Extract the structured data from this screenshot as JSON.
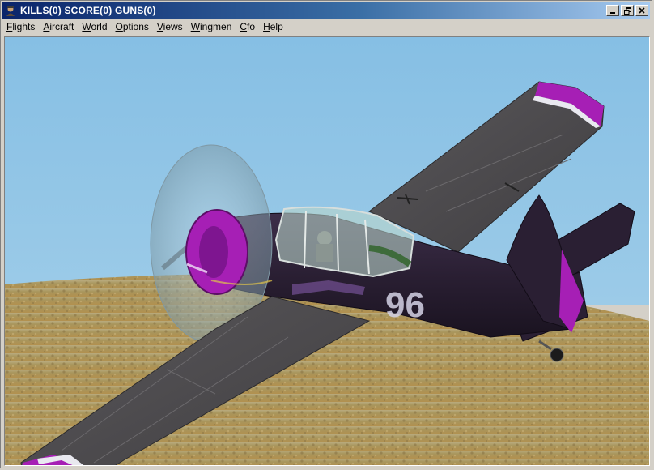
{
  "window": {
    "title": "KILLS(0) SCORE(0) GUNS(0)",
    "icon": "pilot-icon",
    "buttons": {
      "minimize": "minimize-icon",
      "restore": "restore-icon",
      "close": "close-icon"
    }
  },
  "menu": {
    "items": [
      {
        "label": "Flights",
        "name": "flights"
      },
      {
        "label": "Aircraft",
        "name": "aircraft"
      },
      {
        "label": "World",
        "name": "world"
      },
      {
        "label": "Options",
        "name": "options"
      },
      {
        "label": "Views",
        "name": "views"
      },
      {
        "label": "Wingmen",
        "name": "wingmen"
      },
      {
        "label": "Cfo",
        "name": "cfo"
      },
      {
        "label": "Help",
        "name": "help"
      }
    ]
  },
  "scene": {
    "aircraft_number": "96",
    "colors": {
      "sky": "#8cc3e6",
      "ground": "#a8955c",
      "fuselage": "#2a1f33",
      "accent": "#a61fb5",
      "wing": "#4e4c4f"
    }
  }
}
